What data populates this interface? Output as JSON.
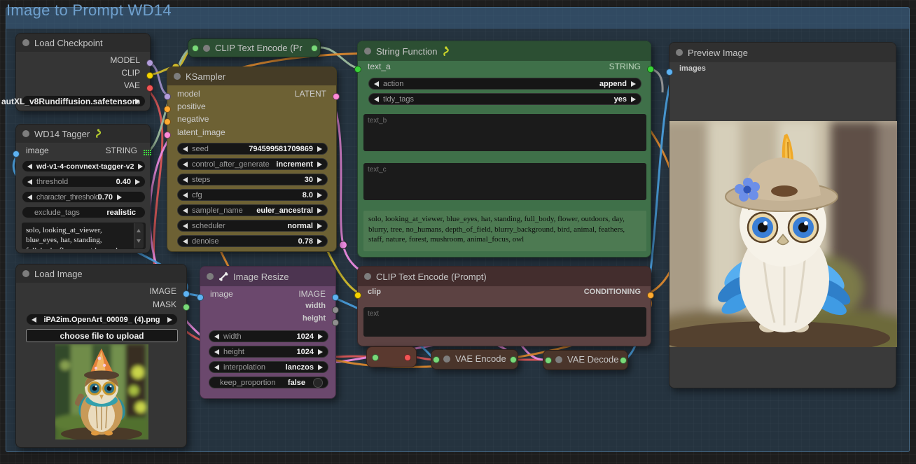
{
  "canvas": {
    "group_title": "Image to Prompt WD14"
  },
  "slot_colors": {
    "model": "#b39ddb",
    "clip": "#f5d300",
    "vae": "#f25555",
    "image": "#5db2f2",
    "mask": "#79d979",
    "latent": "#ff8bd8",
    "conditioning": "#ffab30",
    "string": "#39d439",
    "number": "#8f8f8f"
  },
  "node_colors": {
    "default_body": "#353535",
    "default_header": "#2c2c2c",
    "ksampler_body": "#6d6134",
    "ksampler_header": "#453c26",
    "string_body": "#3f7049",
    "string_header": "#2c4f33",
    "clip_body": "#5c4242",
    "clip_header": "#432d2d",
    "resize_body": "#6b486d",
    "resize_header": "#4c3450",
    "vae_body": "#4a352b",
    "misc_collapsed_body": "#5a392f"
  },
  "nodes": {
    "load_checkpoint": {
      "title": "Load Checkpoint",
      "outputs": [
        "MODEL",
        "CLIP",
        "VAE"
      ],
      "ckpt_name": "autXL_v8Rundiffusion.safetensors"
    },
    "clip_text_encode_collapsed": {
      "title": "CLIP Text Encode (Pr"
    },
    "ksampler": {
      "title": "KSampler",
      "inputs": [
        "model",
        "positive",
        "negative",
        "latent_image"
      ],
      "outputs": [
        "LATENT"
      ],
      "widgets": [
        {
          "label": "seed",
          "value": "794599581709869"
        },
        {
          "label": "control_after_generate",
          "value": "increment"
        },
        {
          "label": "steps",
          "value": "30"
        },
        {
          "label": "cfg",
          "value": "8.0"
        },
        {
          "label": "sampler_name",
          "value": "euler_ancestral"
        },
        {
          "label": "scheduler",
          "value": "normal"
        },
        {
          "label": "denoise",
          "value": "0.78"
        }
      ]
    },
    "wd14_tagger": {
      "title": "WD14 Tagger",
      "inputs": [
        "image"
      ],
      "outputs": [
        "STRING"
      ],
      "widgets": [
        {
          "label": "model",
          "value": "wd-v1-4-convnext-tagger-v2"
        },
        {
          "label": "threshold",
          "value": "0.40"
        },
        {
          "label": "character_threshold",
          "value": "0.70"
        },
        {
          "label": "exclude_tags",
          "value": "realistic"
        }
      ],
      "tags_text": "solo, looking_at_viewer, blue_eyes, hat, standing, full_body, flower, outdoors, day, blurry, tree,"
    },
    "string_function": {
      "title": "String Function",
      "inputs": [
        "text_a"
      ],
      "outputs": [
        "STRING"
      ],
      "widgets": [
        {
          "label": "action",
          "value": "append"
        },
        {
          "label": "tidy_tags",
          "value": "yes"
        }
      ],
      "text_b_placeholder": "text_b",
      "text_c_placeholder": "text_c",
      "result_text": "solo, looking_at_viewer, blue_eyes, hat, standing, full_body, flower, outdoors, day, blurry, tree, no_humans, depth_of_field, blurry_background, bird, animal, feathers, staff, nature, forest, mushroom, animal_focus, owl"
    },
    "load_image": {
      "title": "Load Image",
      "outputs": [
        "IMAGE",
        "MASK"
      ],
      "file_name": "iPA2im.OpenArt_00009_ (4).png",
      "upload_label": "choose file to upload",
      "preview_alt": "owl wearing wizard hat in forest"
    },
    "image_resize": {
      "title": "Image Resize",
      "inputs": [
        "image"
      ],
      "outputs": [
        "IMAGE",
        "width",
        "height"
      ],
      "widgets": [
        {
          "label": "width",
          "value": "1024"
        },
        {
          "label": "height",
          "value": "1024"
        },
        {
          "label": "interpolation",
          "value": "lanczos"
        },
        {
          "label": "keep_proportion",
          "value": "false"
        }
      ]
    },
    "clip_text_encode_prompt": {
      "title": "CLIP Text Encode (Prompt)",
      "inputs": [
        "clip"
      ],
      "outputs": [
        "CONDITIONING"
      ],
      "text_placeholder": "text"
    },
    "vae_encode": {
      "title": "VAE Encode"
    },
    "vae_decode": {
      "title": "VAE Decode"
    },
    "preview_image": {
      "title": "Preview Image",
      "inputs": [
        "images"
      ],
      "preview_alt": "white owl wearing hat with yellow feather"
    }
  }
}
